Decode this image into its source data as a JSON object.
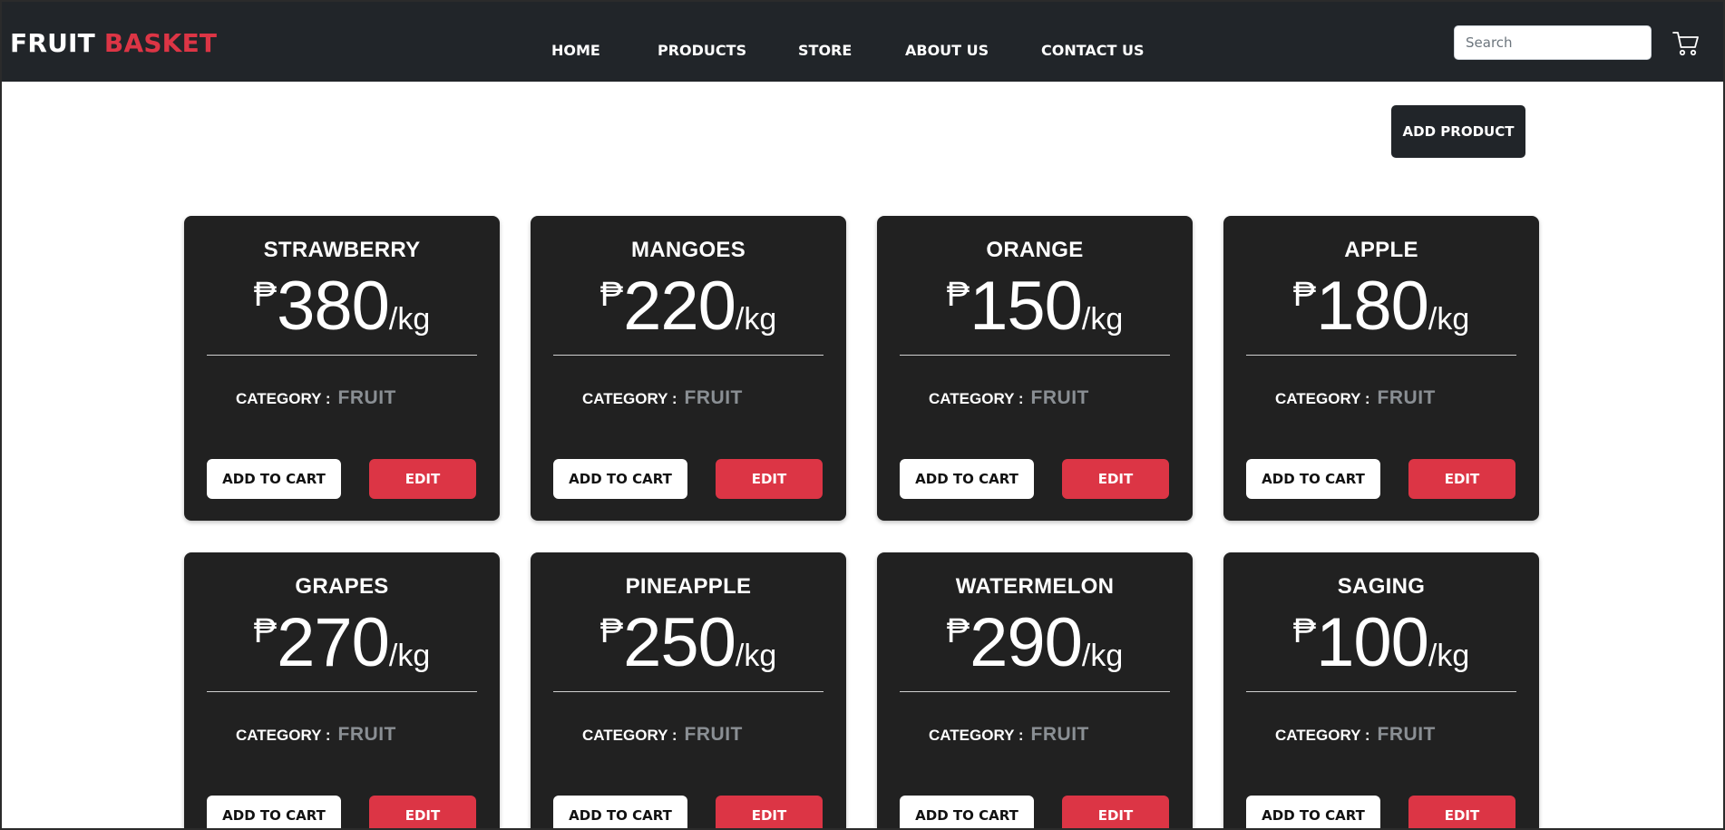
{
  "brand": {
    "first": "FRUIT",
    "second": "BASKET"
  },
  "nav": {
    "items": [
      {
        "label": "HOME",
        "name": "nav-home"
      },
      {
        "label": "PRODUCTS",
        "name": "nav-products"
      },
      {
        "label": "STORE",
        "name": "nav-store"
      },
      {
        "label": "ABOUT US",
        "name": "nav-about-us"
      },
      {
        "label": "CONTACT US",
        "name": "nav-contact-us"
      }
    ]
  },
  "search": {
    "placeholder": "Search",
    "value": ""
  },
  "cart_icon": "cart-icon",
  "add_product_label": "ADD PRODUCT",
  "currency": "₱",
  "unit": "/kg",
  "category_label": "CATEGORY :",
  "add_to_cart_label": "ADD TO CART",
  "edit_label": "EDIT",
  "colors": {
    "accent": "#dc3545",
    "navbar": "#212529",
    "card": "#212121",
    "muted": "#8a8f94"
  },
  "products": [
    {
      "name": "STRAWBERRY",
      "price": "380",
      "category": "FRUIT"
    },
    {
      "name": "MANGOES",
      "price": "220",
      "category": "FRUIT"
    },
    {
      "name": "ORANGE",
      "price": "150",
      "category": "FRUIT"
    },
    {
      "name": "APPLE",
      "price": "180",
      "category": "FRUIT"
    },
    {
      "name": "GRAPES",
      "price": "270",
      "category": "FRUIT"
    },
    {
      "name": "PINEAPPLE",
      "price": "250",
      "category": "FRUIT"
    },
    {
      "name": "WATERMELON",
      "price": "290",
      "category": "FRUIT"
    },
    {
      "name": "SAGING",
      "price": "100",
      "category": "FRUIT"
    }
  ]
}
